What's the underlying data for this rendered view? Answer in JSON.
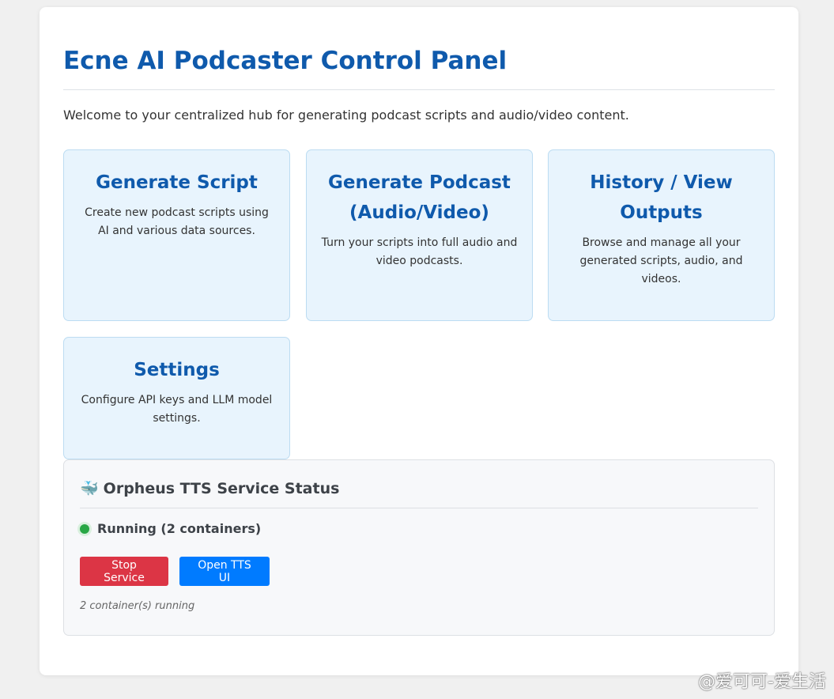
{
  "header": {
    "title": "Ecne AI Podcaster Control Panel",
    "welcome": "Welcome to your centralized hub for generating podcast scripts and audio/video content."
  },
  "cards": [
    {
      "title": "Generate Script",
      "desc": "Create new podcast scripts using AI and various data sources."
    },
    {
      "title": "Generate Podcast (Audio/Video)",
      "desc": "Turn your scripts into full audio and video podcasts."
    },
    {
      "title": "History / View Outputs",
      "desc": "Browse and manage all your generated scripts, audio, and videos."
    },
    {
      "title": "Settings",
      "desc": "Configure API keys and LLM model settings."
    }
  ],
  "status": {
    "icon": "🐳",
    "title": "Orpheus TTS Service Status",
    "state": "Running (2 containers)",
    "state_color": "#28a745",
    "stop_label": "Stop Service",
    "open_label": "Open TTS UI",
    "note": "2 container(s) running"
  },
  "watermark": "@爱可可-爱生活",
  "colors": {
    "accent": "#0f5aac",
    "stop": "#dc3545",
    "open": "#007bff"
  }
}
